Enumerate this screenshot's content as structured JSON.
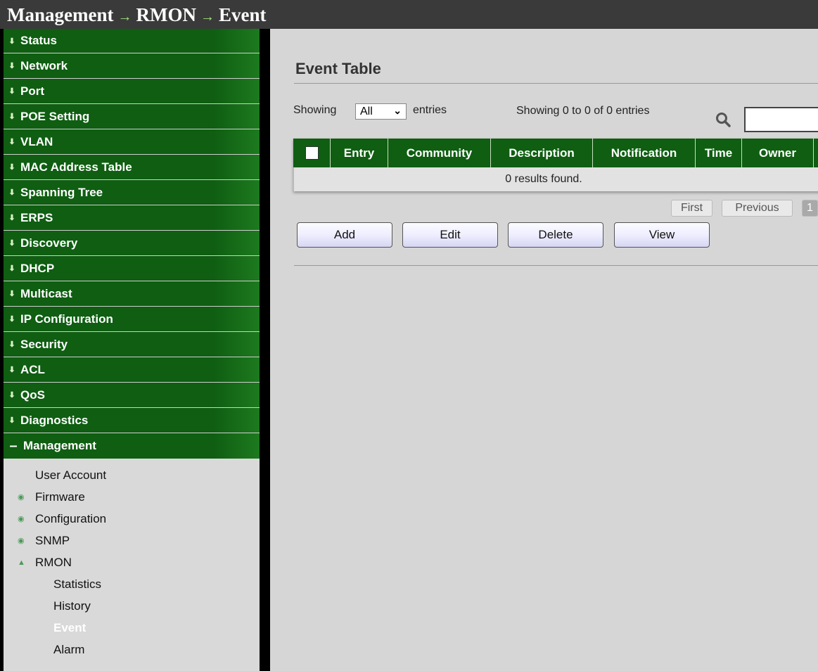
{
  "breadcrumb": [
    "Management",
    "RMON",
    "Event"
  ],
  "breadcrumb_separator": "→",
  "sidebar": {
    "items": [
      {
        "label": "Status"
      },
      {
        "label": "Network"
      },
      {
        "label": "Port"
      },
      {
        "label": "POE Setting"
      },
      {
        "label": "VLAN"
      },
      {
        "label": "MAC Address Table"
      },
      {
        "label": "Spanning Tree"
      },
      {
        "label": "ERPS"
      },
      {
        "label": "Discovery"
      },
      {
        "label": "DHCP"
      },
      {
        "label": "Multicast"
      },
      {
        "label": "IP Configuration"
      },
      {
        "label": "Security"
      },
      {
        "label": "ACL"
      },
      {
        "label": "QoS"
      },
      {
        "label": "Diagnostics"
      }
    ],
    "open_item": {
      "label": "Management",
      "toggle": "–"
    },
    "sub_items": [
      {
        "label": "User Account",
        "icon": "none"
      },
      {
        "label": "Firmware",
        "icon": "chevron-down-icon"
      },
      {
        "label": "Configuration",
        "icon": "chevron-down-icon"
      },
      {
        "label": "SNMP",
        "icon": "chevron-down-icon"
      },
      {
        "label": "RMON",
        "icon": "chevron-up-icon"
      }
    ],
    "rmon_items": [
      {
        "label": "Statistics",
        "active": false
      },
      {
        "label": "History",
        "active": false
      },
      {
        "label": "Event",
        "active": true
      },
      {
        "label": "Alarm",
        "active": false
      }
    ]
  },
  "main": {
    "title": "Event Table",
    "showing_label": "Showing",
    "page_size": "All",
    "entries_label": "entries",
    "info": "Showing 0 to 0 of 0 entries",
    "search_value": "",
    "table": {
      "columns": [
        "Entry",
        "Community",
        "Description",
        "Notification",
        "Time",
        "Owner"
      ],
      "empty_message": "0 results found."
    },
    "pagination": {
      "first": "First",
      "previous": "Previous",
      "current": "1"
    },
    "buttons": {
      "add": "Add",
      "edit": "Edit",
      "delete": "Delete",
      "view": "View"
    }
  },
  "colors": {
    "menu_green": "#0f5e12",
    "title_bar": "#3a3a3a",
    "content_bg": "#d6d6d6",
    "sidebar_bg": "#d9d9d9"
  }
}
